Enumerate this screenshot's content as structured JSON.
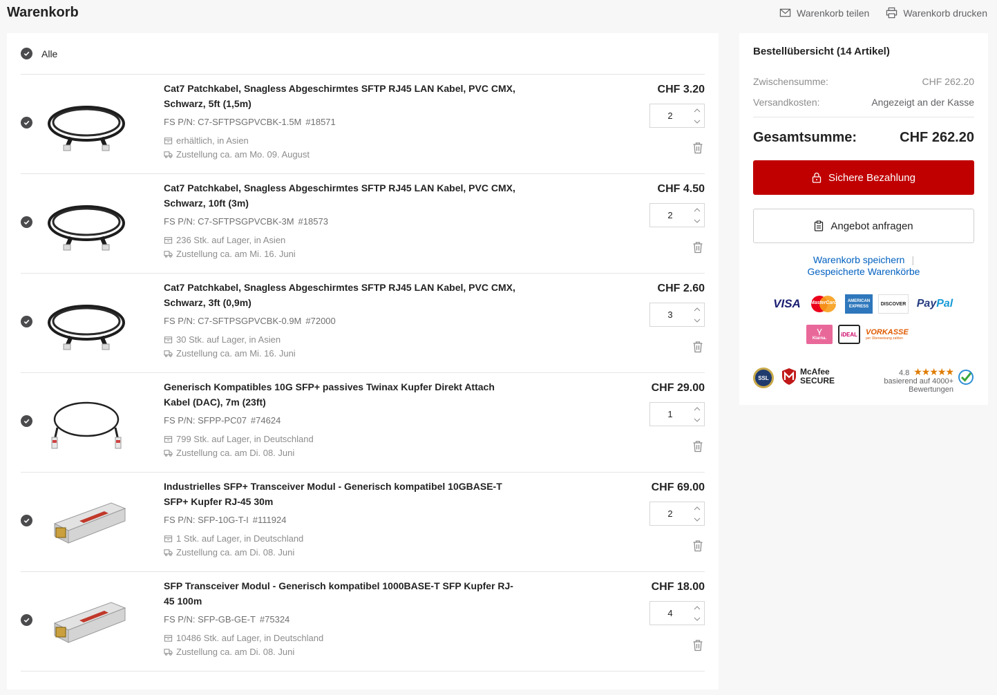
{
  "header": {
    "title": "Warenkorb",
    "share_label": "Warenkorb teilen",
    "print_label": "Warenkorb drucken"
  },
  "cart": {
    "select_all_label": "Alle",
    "items": [
      {
        "title": "Cat7 Patchkabel, Snagless Abgeschirmtes SFTP RJ45 LAN Kabel, PVC CMX, Schwarz, 5ft (1,5m)",
        "pn": "FS P/N: C7-SFTPSGPVCBK-1.5M",
        "id": "#18571",
        "stock": "erhältlich, in Asien",
        "delivery": "Zustellung ca. am Mo. 09. August",
        "price": "CHF 3.20",
        "qty": "2",
        "image": "black-patch-cable"
      },
      {
        "title": "Cat7 Patchkabel, Snagless Abgeschirmtes SFTP RJ45 LAN Kabel, PVC CMX, Schwarz, 10ft (3m)",
        "pn": "FS P/N: C7-SFTPSGPVCBK-3M",
        "id": "#18573",
        "stock": "236 Stk. auf Lager, in Asien",
        "delivery": "Zustellung ca. am Mi. 16. Juni",
        "price": "CHF 4.50",
        "qty": "2",
        "image": "black-patch-cable"
      },
      {
        "title": "Cat7 Patchkabel, Snagless Abgeschirmtes SFTP RJ45 LAN Kabel, PVC CMX, Schwarz, 3ft (0,9m)",
        "pn": "FS P/N: C7-SFTPSGPVCBK-0.9M",
        "id": "#72000",
        "stock": "30 Stk. auf Lager, in Asien",
        "delivery": "Zustellung ca. am Mi. 16. Juni",
        "price": "CHF 2.60",
        "qty": "3",
        "image": "black-patch-cable"
      },
      {
        "title": "Generisch Kompatibles 10G SFP+ passives Twinax Kupfer Direkt Attach Kabel (DAC), 7m (23ft)",
        "pn": "FS P/N: SFPP-PC07",
        "id": "#74624",
        "stock": "799 Stk. auf Lager, in Deutschland",
        "delivery": "Zustellung ca. am Di. 08. Juni",
        "price": "CHF 29.00",
        "qty": "1",
        "image": "dac-cable"
      },
      {
        "title": "Industrielles SFP+ Transceiver Modul - Generisch kompatibel 10GBASE-T SFP+ Kupfer RJ-45 30m",
        "pn": "FS P/N: SFP-10G-T-I",
        "id": "#111924",
        "stock": "1 Stk. auf Lager, in Deutschland",
        "delivery": "Zustellung ca. am Di. 08. Juni",
        "price": "CHF 69.00",
        "qty": "2",
        "image": "sfp-module"
      },
      {
        "title": "SFP Transceiver Modul - Generisch kompatibel 1000BASE-T SFP Kupfer RJ-45 100m",
        "pn": "FS P/N: SFP-GB-GE-T",
        "id": "#75324",
        "stock": "10486 Stk. auf Lager, in Deutschland",
        "delivery": "Zustellung ca. am Di. 08. Juni",
        "price": "CHF 18.00",
        "qty": "4",
        "image": "sfp-module"
      }
    ]
  },
  "summary": {
    "title": "Bestellübersicht (14 Artikel)",
    "subtotal_label": "Zwischensumme:",
    "subtotal_value": "CHF 262.20",
    "shipping_label": "Versandkosten:",
    "shipping_value": "Angezeigt an der Kasse",
    "total_label": "Gesamtsumme:",
    "total_value": "CHF 262.20",
    "pay_button": "Sichere Bezahlung",
    "quote_button": "Angebot anfragen",
    "save_cart_link": "Warenkorb speichern",
    "saved_carts_link": "Gespeicherte Warenkörbe",
    "payment_logos": {
      "visa": "VISA",
      "mastercard": "MasterCard",
      "amex_1": "AMERICAN",
      "amex_2": "EXPRESS",
      "discover": "DISCOVER",
      "paypal_1": "Pay",
      "paypal_2": "Pal",
      "klarna": "Klarna.",
      "ideal": "iDEAL",
      "vorkasse": "VORKASSE",
      "vorkasse_sub": "per Überweisung zahlen"
    },
    "trust": {
      "ssl": "SSL",
      "mcafee_1": "McAfee",
      "mcafee_2": "SECURE",
      "rating_score": "4.8",
      "rating_stars": "★★★★★",
      "rating_line1": "basierend auf 4000+",
      "rating_line2": "Bewertungen"
    }
  },
  "colors": {
    "accent_red": "#c00000",
    "link_blue": "#0060bf",
    "check_dark": "#4b4b4d"
  }
}
